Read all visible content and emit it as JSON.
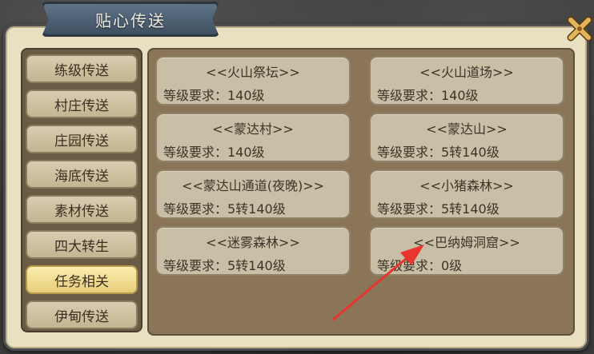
{
  "window": {
    "title": "贴心传送"
  },
  "tabs": [
    {
      "label": "练级传送"
    },
    {
      "label": "村庄传送"
    },
    {
      "label": "庄园传送"
    },
    {
      "label": "海底传送"
    },
    {
      "label": "素材传送"
    },
    {
      "label": "四大转生"
    },
    {
      "label": "任务相关",
      "active": true
    },
    {
      "label": "伊甸传送"
    }
  ],
  "destinations": [
    {
      "title": "<<火山祭坛>>",
      "requirement": "等级要求：140级"
    },
    {
      "title": "<<火山道场>>",
      "requirement": "等级要求：140级"
    },
    {
      "title": "<<蒙达村>>",
      "requirement": "等级要求：140级"
    },
    {
      "title": "<<蒙达山>>",
      "requirement": "等级要求：5转140级"
    },
    {
      "title": "<<蒙达山通道(夜晚)>>",
      "requirement": "等级要求：5转140级"
    },
    {
      "title": "<<小猪森林>>",
      "requirement": "等级要求：5转140级"
    },
    {
      "title": "<<迷雾森林>>",
      "requirement": "等级要求：5转140级"
    },
    {
      "title": "<<巴纳姆洞窟>>",
      "requirement": "等级要求：0级"
    }
  ],
  "colors": {
    "active_tab": "#e6ce79",
    "arrow": "#e8352e"
  },
  "icons": {
    "close": "close-cross-icon"
  }
}
